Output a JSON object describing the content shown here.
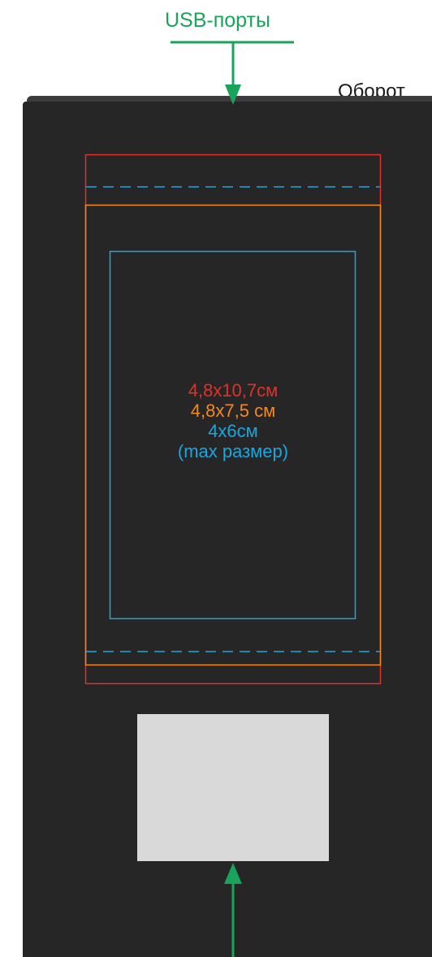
{
  "labels": {
    "usb_ports": "USB-порты",
    "back_side": "Оборот"
  },
  "sizes": {
    "outer": "4,8x10,7см",
    "middle": "4,8x7,5 см",
    "inner": "4x6см",
    "inner_note": "(max размер)"
  },
  "colors": {
    "accent_green": "#1aa35a",
    "outer_red": "#e0312b",
    "middle_orange": "#f5891f",
    "inner_blue": "#1aa6df",
    "device_body": "#262626",
    "photo_window": "#d9d9d9"
  }
}
